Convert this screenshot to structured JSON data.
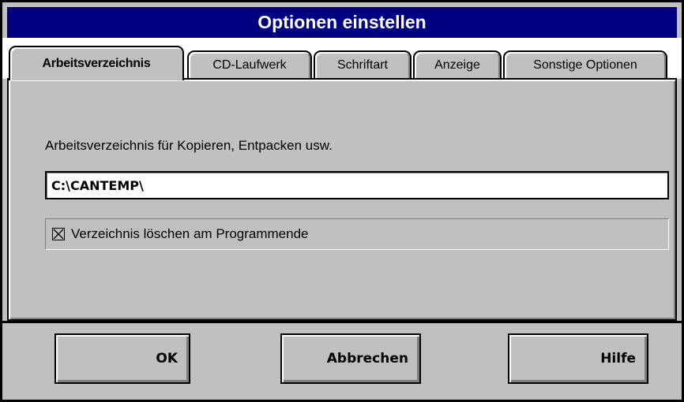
{
  "window": {
    "title": "Optionen einstellen"
  },
  "tabs": [
    {
      "label": "Arbeitsverzeichnis",
      "active": true
    },
    {
      "label": "CD-Laufwerk",
      "active": false
    },
    {
      "label": "Schriftart",
      "active": false
    },
    {
      "label": "Anzeige",
      "active": false
    },
    {
      "label": "Sonstige Optionen",
      "active": false
    }
  ],
  "panel": {
    "label": "Arbeitsverzeichnis für Kopieren, Entpacken usw.",
    "path_value": "C:\\CANTEMP\\",
    "checkbox": {
      "label": "Verzeichnis löschen am Programmende",
      "checked": true
    }
  },
  "buttons": {
    "ok": "OK",
    "cancel": "Abbrechen",
    "help": "Hilfe"
  },
  "colors": {
    "titlebar": "#000080",
    "face": "#c0c0c0"
  }
}
